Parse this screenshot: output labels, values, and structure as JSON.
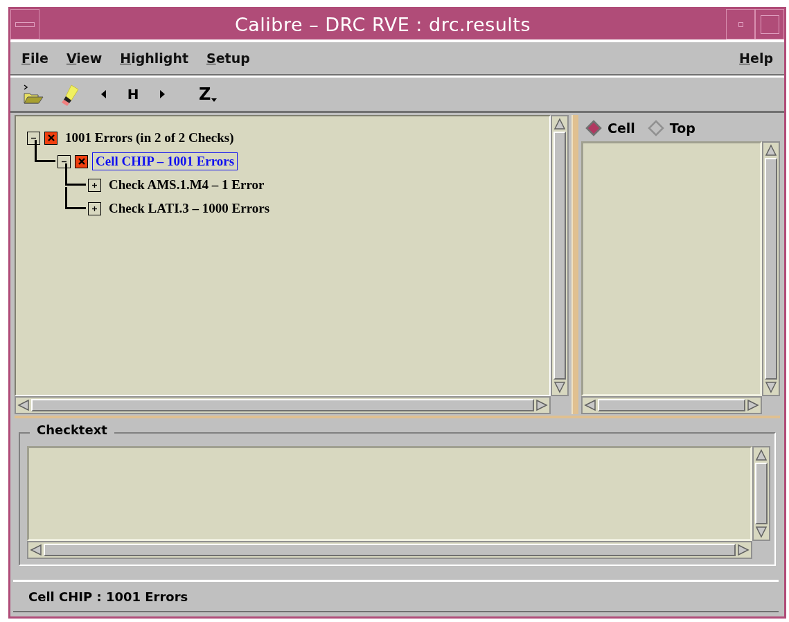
{
  "window": {
    "title": "Calibre – DRC RVE : drc.results"
  },
  "menu": [
    {
      "label": "File"
    },
    {
      "label": "View"
    },
    {
      "label": "Highlight"
    },
    {
      "label": "Setup"
    }
  ],
  "help_menu": {
    "label": "Help"
  },
  "toolbar": [
    {
      "kind": "open"
    },
    {
      "kind": "highlight"
    },
    {
      "kind": "prev"
    },
    {
      "kind": "text",
      "label": "H"
    },
    {
      "kind": "next"
    },
    {
      "kind": "zoom",
      "label": "Z"
    }
  ],
  "tree": [
    {
      "label": "1001 Errors (in 2 of 2 Checks)",
      "expanded": true,
      "selected": false,
      "error": true,
      "children": [
        {
          "label": "Cell CHIP – 1001 Errors",
          "expanded": true,
          "selected": true,
          "error": true,
          "children": [
            {
              "label": "Check AMS.1.M4 – 1 Error",
              "expanded": false,
              "selected": false,
              "error": false
            },
            {
              "label": "Check LATI.3 – 1000 Errors",
              "expanded": false,
              "selected": false,
              "error": false
            }
          ]
        }
      ]
    }
  ],
  "view_options": [
    {
      "label": "Cell",
      "selected": true
    },
    {
      "label": "Top",
      "selected": false
    }
  ],
  "checktext": {
    "title": "Checktext"
  },
  "status_bar": "Cell CHIP : 1001 Errors"
}
